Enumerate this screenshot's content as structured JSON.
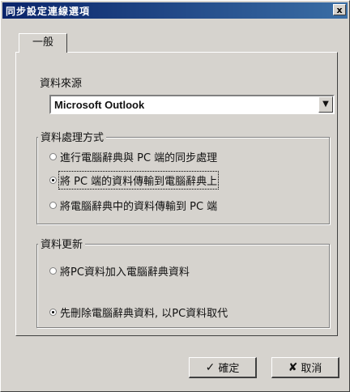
{
  "window": {
    "title": "同步設定連線選項",
    "close_glyph": "x"
  },
  "tabs": [
    {
      "label": "一般"
    }
  ],
  "data_source": {
    "label": "資料來源",
    "selected": "Microsoft Outlook",
    "arrow_glyph": "▼"
  },
  "processing": {
    "label": "資料處理方式",
    "options": [
      {
        "label": "進行電腦辭典與 PC 端的同步處理",
        "selected": false
      },
      {
        "label": "將 PC 端的資料傳輸到電腦辭典上",
        "selected": true
      },
      {
        "label": "將電腦辭典中的資料傳輸到 PC 端",
        "selected": false
      }
    ]
  },
  "update": {
    "label": "資料更新",
    "options": [
      {
        "label": "將PC資料加入電腦辭典資料",
        "selected": false
      },
      {
        "label": "先刪除電腦辭典資料, 以PC資料取代",
        "selected": true
      }
    ]
  },
  "buttons": {
    "ok": {
      "label": "確定",
      "icon": "✓"
    },
    "cancel": {
      "label": "取消",
      "icon": "✘"
    }
  }
}
